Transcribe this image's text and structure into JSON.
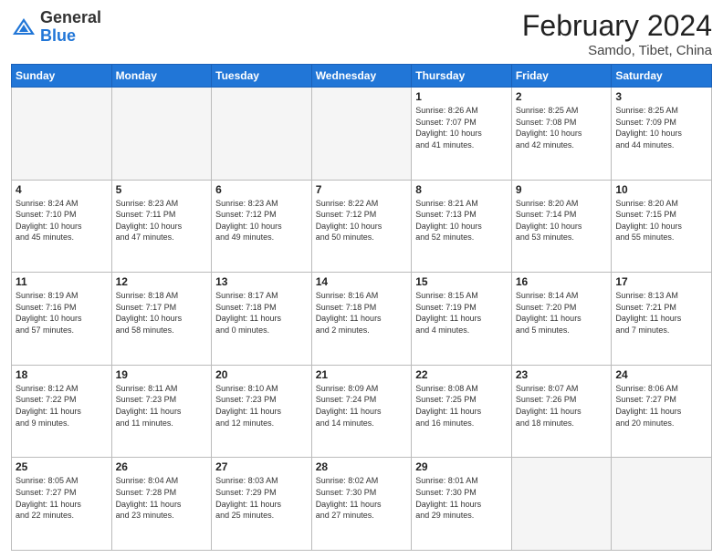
{
  "header": {
    "logo": {
      "general": "General",
      "blue": "Blue"
    },
    "title": "February 2024",
    "location": "Samdo, Tibet, China"
  },
  "weekdays": [
    "Sunday",
    "Monday",
    "Tuesday",
    "Wednesday",
    "Thursday",
    "Friday",
    "Saturday"
  ],
  "weeks": [
    [
      {
        "day": "",
        "info": ""
      },
      {
        "day": "",
        "info": ""
      },
      {
        "day": "",
        "info": ""
      },
      {
        "day": "",
        "info": ""
      },
      {
        "day": "1",
        "info": "Sunrise: 8:26 AM\nSunset: 7:07 PM\nDaylight: 10 hours\nand 41 minutes."
      },
      {
        "day": "2",
        "info": "Sunrise: 8:25 AM\nSunset: 7:08 PM\nDaylight: 10 hours\nand 42 minutes."
      },
      {
        "day": "3",
        "info": "Sunrise: 8:25 AM\nSunset: 7:09 PM\nDaylight: 10 hours\nand 44 minutes."
      }
    ],
    [
      {
        "day": "4",
        "info": "Sunrise: 8:24 AM\nSunset: 7:10 PM\nDaylight: 10 hours\nand 45 minutes."
      },
      {
        "day": "5",
        "info": "Sunrise: 8:23 AM\nSunset: 7:11 PM\nDaylight: 10 hours\nand 47 minutes."
      },
      {
        "day": "6",
        "info": "Sunrise: 8:23 AM\nSunset: 7:12 PM\nDaylight: 10 hours\nand 49 minutes."
      },
      {
        "day": "7",
        "info": "Sunrise: 8:22 AM\nSunset: 7:12 PM\nDaylight: 10 hours\nand 50 minutes."
      },
      {
        "day": "8",
        "info": "Sunrise: 8:21 AM\nSunset: 7:13 PM\nDaylight: 10 hours\nand 52 minutes."
      },
      {
        "day": "9",
        "info": "Sunrise: 8:20 AM\nSunset: 7:14 PM\nDaylight: 10 hours\nand 53 minutes."
      },
      {
        "day": "10",
        "info": "Sunrise: 8:20 AM\nSunset: 7:15 PM\nDaylight: 10 hours\nand 55 minutes."
      }
    ],
    [
      {
        "day": "11",
        "info": "Sunrise: 8:19 AM\nSunset: 7:16 PM\nDaylight: 10 hours\nand 57 minutes."
      },
      {
        "day": "12",
        "info": "Sunrise: 8:18 AM\nSunset: 7:17 PM\nDaylight: 10 hours\nand 58 minutes."
      },
      {
        "day": "13",
        "info": "Sunrise: 8:17 AM\nSunset: 7:18 PM\nDaylight: 11 hours\nand 0 minutes."
      },
      {
        "day": "14",
        "info": "Sunrise: 8:16 AM\nSunset: 7:18 PM\nDaylight: 11 hours\nand 2 minutes."
      },
      {
        "day": "15",
        "info": "Sunrise: 8:15 AM\nSunset: 7:19 PM\nDaylight: 11 hours\nand 4 minutes."
      },
      {
        "day": "16",
        "info": "Sunrise: 8:14 AM\nSunset: 7:20 PM\nDaylight: 11 hours\nand 5 minutes."
      },
      {
        "day": "17",
        "info": "Sunrise: 8:13 AM\nSunset: 7:21 PM\nDaylight: 11 hours\nand 7 minutes."
      }
    ],
    [
      {
        "day": "18",
        "info": "Sunrise: 8:12 AM\nSunset: 7:22 PM\nDaylight: 11 hours\nand 9 minutes."
      },
      {
        "day": "19",
        "info": "Sunrise: 8:11 AM\nSunset: 7:23 PM\nDaylight: 11 hours\nand 11 minutes."
      },
      {
        "day": "20",
        "info": "Sunrise: 8:10 AM\nSunset: 7:23 PM\nDaylight: 11 hours\nand 12 minutes."
      },
      {
        "day": "21",
        "info": "Sunrise: 8:09 AM\nSunset: 7:24 PM\nDaylight: 11 hours\nand 14 minutes."
      },
      {
        "day": "22",
        "info": "Sunrise: 8:08 AM\nSunset: 7:25 PM\nDaylight: 11 hours\nand 16 minutes."
      },
      {
        "day": "23",
        "info": "Sunrise: 8:07 AM\nSunset: 7:26 PM\nDaylight: 11 hours\nand 18 minutes."
      },
      {
        "day": "24",
        "info": "Sunrise: 8:06 AM\nSunset: 7:27 PM\nDaylight: 11 hours\nand 20 minutes."
      }
    ],
    [
      {
        "day": "25",
        "info": "Sunrise: 8:05 AM\nSunset: 7:27 PM\nDaylight: 11 hours\nand 22 minutes."
      },
      {
        "day": "26",
        "info": "Sunrise: 8:04 AM\nSunset: 7:28 PM\nDaylight: 11 hours\nand 23 minutes."
      },
      {
        "day": "27",
        "info": "Sunrise: 8:03 AM\nSunset: 7:29 PM\nDaylight: 11 hours\nand 25 minutes."
      },
      {
        "day": "28",
        "info": "Sunrise: 8:02 AM\nSunset: 7:30 PM\nDaylight: 11 hours\nand 27 minutes."
      },
      {
        "day": "29",
        "info": "Sunrise: 8:01 AM\nSunset: 7:30 PM\nDaylight: 11 hours\nand 29 minutes."
      },
      {
        "day": "",
        "info": ""
      },
      {
        "day": "",
        "info": ""
      }
    ]
  ]
}
